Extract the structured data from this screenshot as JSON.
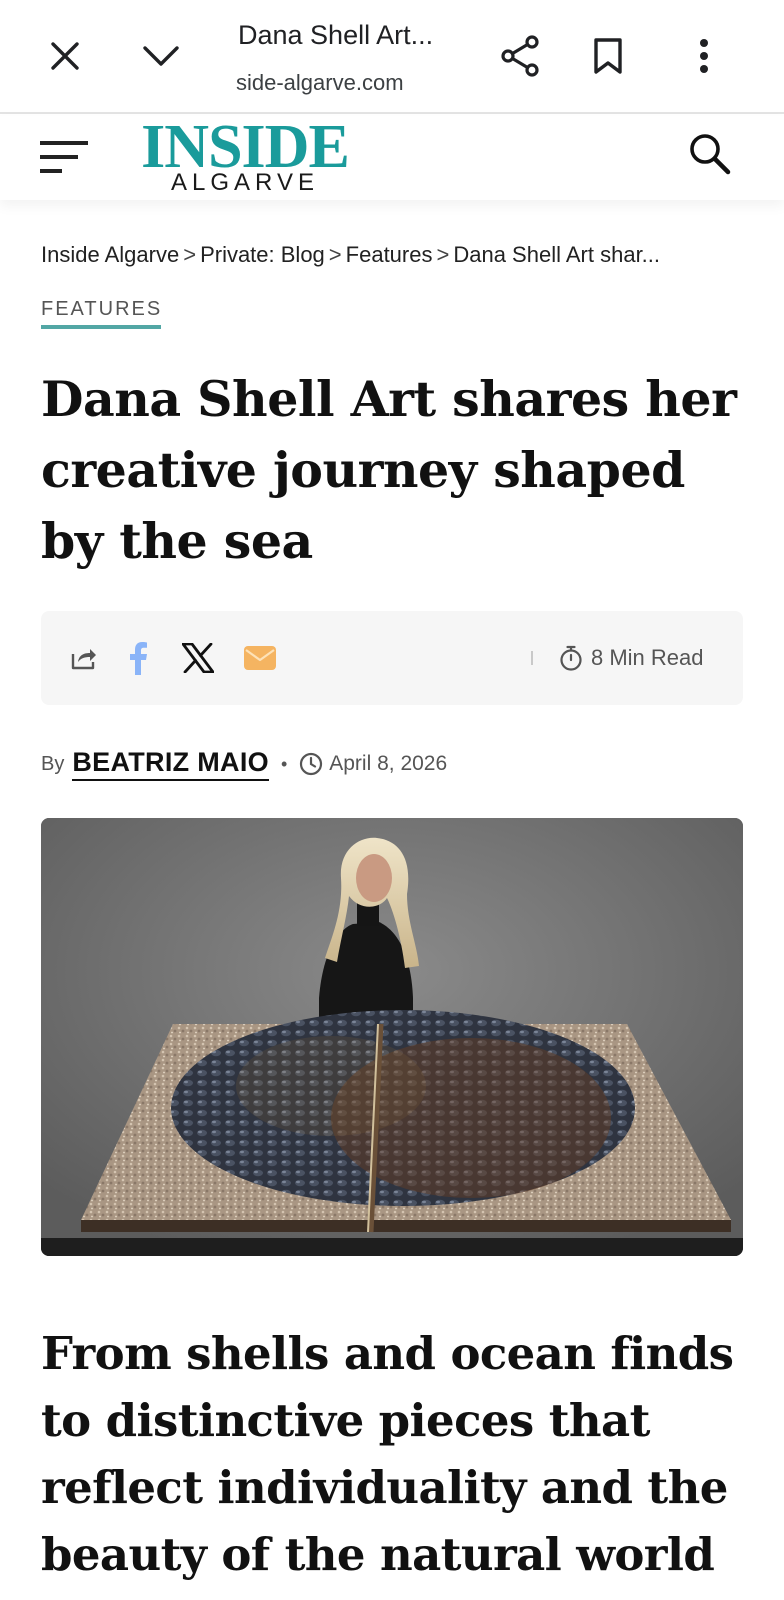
{
  "browser": {
    "tab_title": "Dana Shell Art...",
    "url": "side-algarve.com"
  },
  "site": {
    "logo_top": "INSIDE",
    "logo_bottom": "ALGARVE",
    "brand_color": "#1a9b9b"
  },
  "breadcrumb": {
    "items": [
      "Inside Algarve",
      "Private: Blog",
      "Features",
      "Dana Shell Art shar..."
    ],
    "separator": ">"
  },
  "article": {
    "category": "FEATURES",
    "title": "Dana Shell Art shares her creative journey shaped by the sea",
    "read_time": "8 Min Read",
    "by_label": "By",
    "author": "BEATRIZ MAIO",
    "date": "April 8, 2026",
    "subheading": "From shells and ocean finds to distinctive pieces that reflect individuality and the beauty of the natural world"
  },
  "share": {
    "icons": [
      "share-icon",
      "facebook-icon",
      "x-icon",
      "email-icon"
    ],
    "facebook_color": "#8ab4f8",
    "email_color": "#f5b461"
  }
}
